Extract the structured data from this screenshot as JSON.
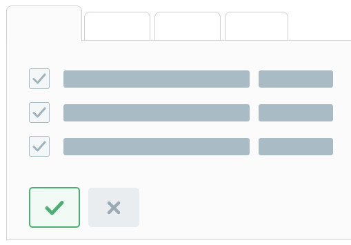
{
  "tabs": [
    {
      "label": ""
    },
    {
      "label": ""
    },
    {
      "label": ""
    },
    {
      "label": ""
    }
  ],
  "rows": [
    {
      "checked": true
    },
    {
      "checked": true
    },
    {
      "checked": true
    }
  ],
  "buttons": {
    "confirm_icon": "check-icon",
    "cancel_icon": "close-icon"
  },
  "colors": {
    "accent_green": "#4cae72",
    "placeholder_bar": "#a9bcc6",
    "check_mark": "#9fb3be",
    "cancel_icon": "#9aabb6"
  }
}
